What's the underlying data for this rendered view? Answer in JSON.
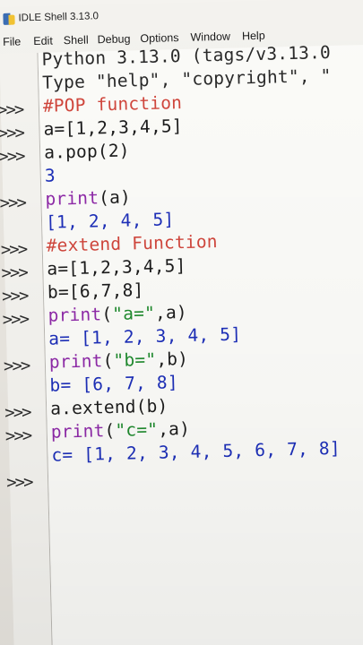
{
  "window": {
    "title": "IDLE Shell 3.13.0"
  },
  "menu": [
    "File",
    "Edit",
    "Shell",
    "Debug",
    "Options",
    "Window",
    "Help"
  ],
  "prompt": ">>>",
  "lines": [
    {
      "text": "Python 3.13.0 (tags/v3.13.0",
      "kind": "banner"
    },
    {
      "text": "Type \"help\", \"copyright\", \"",
      "kind": "banner"
    },
    {
      "text": "#POP function",
      "kind": "comment"
    },
    {
      "text": "a=[1,2,3,4,5]",
      "kind": "code"
    },
    {
      "text": "a.pop(2)",
      "kind": "code"
    },
    {
      "text": "3",
      "kind": "out"
    },
    {
      "text": "print(a)",
      "kind": "code"
    },
    {
      "text": "[1, 2, 4, 5]",
      "kind": "out"
    },
    {
      "text": "#extend Function",
      "kind": "comment"
    },
    {
      "text": "a=[1,2,3,4,5]",
      "kind": "code"
    },
    {
      "text": "b=[6,7,8]",
      "kind": "code"
    },
    {
      "text": "print(\"a=\",a)",
      "kind": "code"
    },
    {
      "text": "a= [1, 2, 3, 4, 5]",
      "kind": "out"
    },
    {
      "text": "print(\"b=\",b)",
      "kind": "code"
    },
    {
      "text": "b= [6, 7, 8]",
      "kind": "out"
    },
    {
      "text": "a.extend(b)",
      "kind": "code"
    },
    {
      "text": "print(\"c=\",a)",
      "kind": "code"
    },
    {
      "text": "c= [1, 2, 3, 4, 5, 6, 7, 8]",
      "kind": "out"
    },
    {
      "text": "",
      "kind": "code"
    }
  ],
  "colors": {
    "code": "#1c1c1c",
    "output": "#1d2fb8",
    "comment": "#d0463c",
    "string": "#1f8a2e",
    "builtin": "#8e2aa8"
  }
}
